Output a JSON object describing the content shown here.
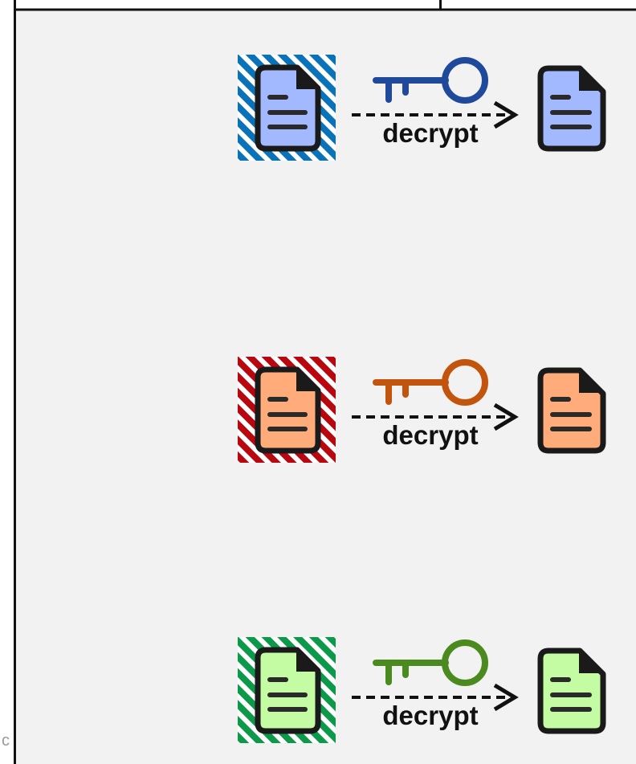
{
  "edge_text": "c",
  "rows": [
    {
      "label": "decrypt",
      "stripe": "#0a72b8",
      "doc_fill": "#a2b9ff",
      "key_color": "#1f4a9c",
      "doc_icon": "document-icon",
      "key_icon": "key-icon"
    },
    {
      "label": "decrypt",
      "stripe": "#b8070f",
      "doc_fill": "#ffac7a",
      "key_color": "#c3540e",
      "doc_icon": "document-icon",
      "key_icon": "key-icon"
    },
    {
      "label": "decrypt",
      "stripe": "#0c9a4a",
      "doc_fill": "#c3fca3",
      "key_color": "#4a8a1e",
      "doc_icon": "document-icon",
      "key_icon": "key-icon"
    }
  ],
  "colors": {
    "panel_bg": "#f2f2f2",
    "border": "#111111",
    "doc_outline": "#1a1a1a"
  }
}
